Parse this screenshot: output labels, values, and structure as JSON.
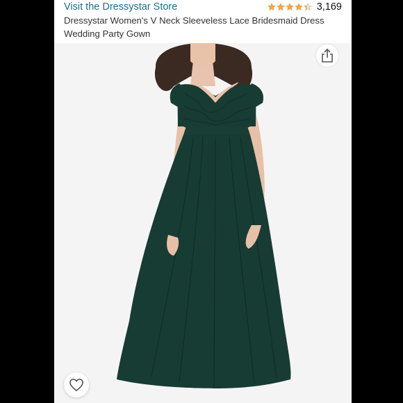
{
  "store": {
    "link_label": "Visit the Dressystar Store"
  },
  "rating": {
    "stars": 4.3,
    "count": "3,169",
    "star_color": "#f3a847"
  },
  "product": {
    "title": "Dressystar Women's V Neck Sleeveless Lace Bridesmaid Dress Wedding Party Gown"
  },
  "icons": {
    "share": "share-icon",
    "like": "heart-icon"
  },
  "colors": {
    "link": "#1f6e8c",
    "dress": "#173c33"
  }
}
